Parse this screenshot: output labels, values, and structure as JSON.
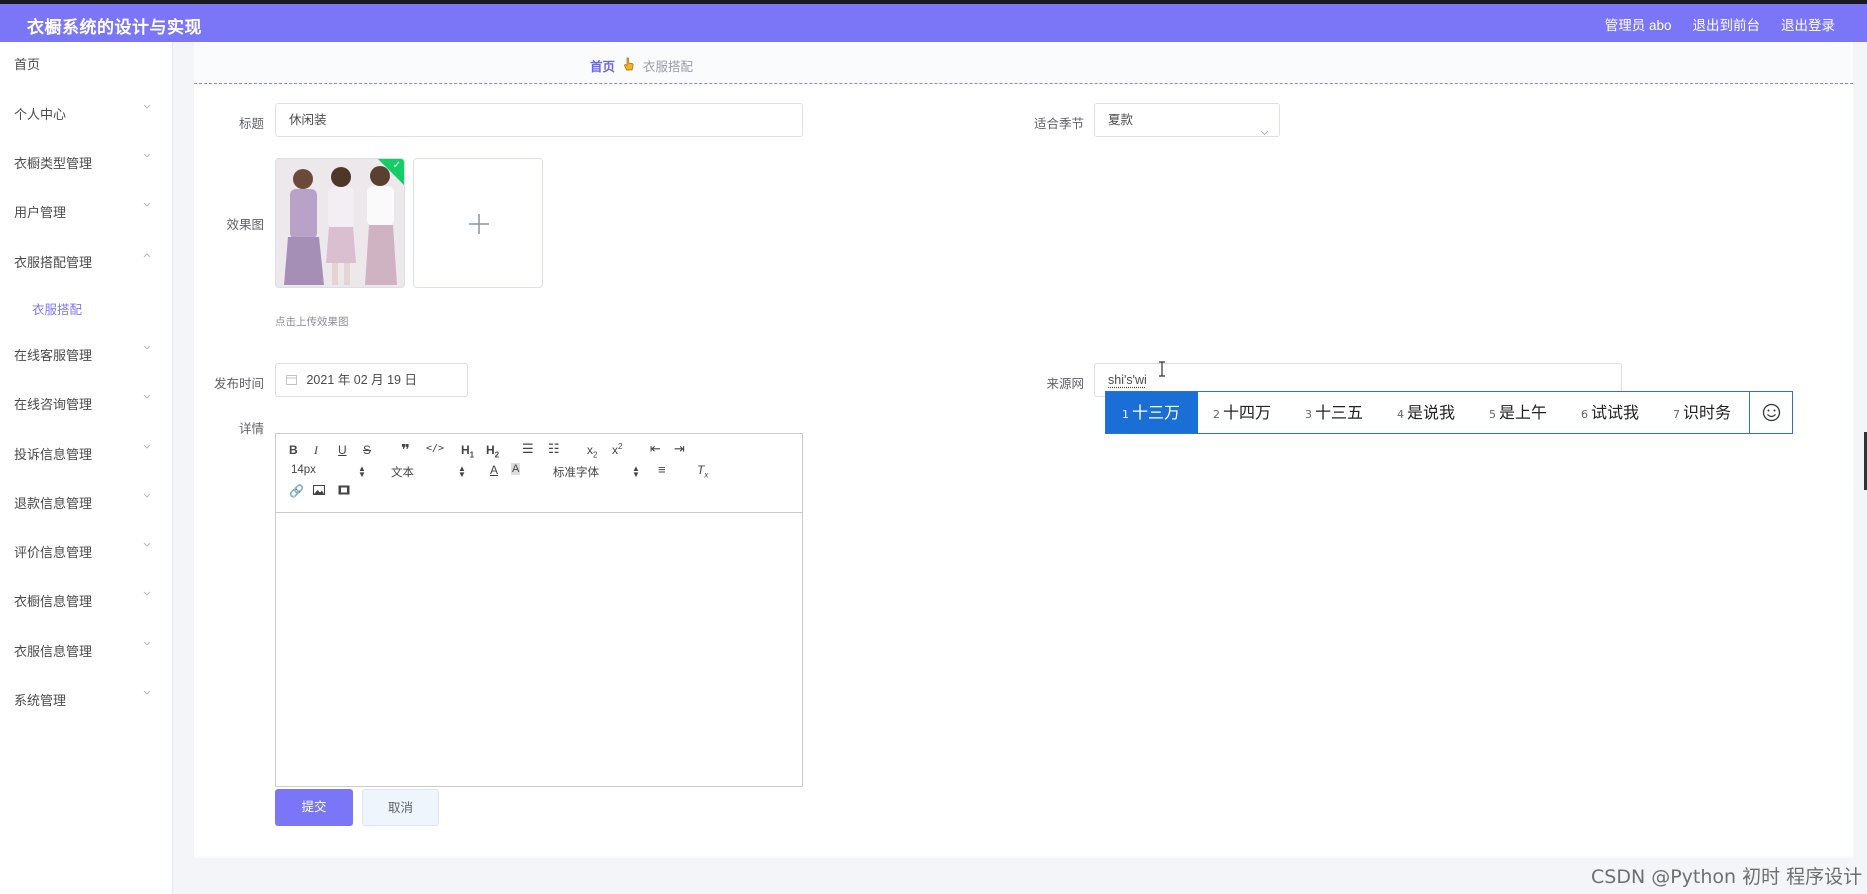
{
  "header": {
    "title": "衣橱系统的设计与实现",
    "user": "管理员 abo",
    "to_front": "退出到前台",
    "logout": "退出登录"
  },
  "sidebar": {
    "items": [
      {
        "label": "首页",
        "chevron": false
      },
      {
        "label": "个人中心",
        "chevron": true
      },
      {
        "label": "衣橱类型管理",
        "chevron": true
      },
      {
        "label": "用户管理",
        "chevron": true
      },
      {
        "label": "衣服搭配管理",
        "chevron": true,
        "expanded": true
      },
      {
        "label": "衣服搭配",
        "sub": true
      },
      {
        "label": "在线客服管理",
        "chevron": true
      },
      {
        "label": "在线咨询管理",
        "chevron": true
      },
      {
        "label": "投诉信息管理",
        "chevron": true
      },
      {
        "label": "退款信息管理",
        "chevron": true
      },
      {
        "label": "评价信息管理",
        "chevron": true
      },
      {
        "label": "衣橱信息管理",
        "chevron": true
      },
      {
        "label": "衣服信息管理",
        "chevron": true
      },
      {
        "label": "系统管理",
        "chevron": true
      }
    ]
  },
  "breadcrumb": {
    "home": "首页",
    "current": "衣服搭配"
  },
  "form": {
    "title_label": "标题",
    "title_value": "休闲装",
    "season_label": "适合季节",
    "season_value": "夏款",
    "image_label": "效果图",
    "image_hint": "点击上传效果图",
    "date_label": "发布时间",
    "date_value": "2021 年 02 月 19 日",
    "source_label": "来源网",
    "source_value": "shi's'wi",
    "detail_label": "详情",
    "submit": "提交",
    "cancel": "取消"
  },
  "editor": {
    "font_size": "14px",
    "header": "文本",
    "font_family": "标准字体"
  },
  "ime": {
    "candidates": [
      {
        "n": "1",
        "text": "十三万",
        "selected": true
      },
      {
        "n": "2",
        "text": "十四万"
      },
      {
        "n": "3",
        "text": "十三五"
      },
      {
        "n": "4",
        "text": "是说我"
      },
      {
        "n": "5",
        "text": "是上午"
      },
      {
        "n": "6",
        "text": "试试我"
      },
      {
        "n": "7",
        "text": "识时务"
      }
    ]
  },
  "watermark": "CSDN @Python 初时 程序设计",
  "colors": {
    "accent": "#7b76f8",
    "ime_selected": "#1a6fd6",
    "success": "#13ce66"
  }
}
